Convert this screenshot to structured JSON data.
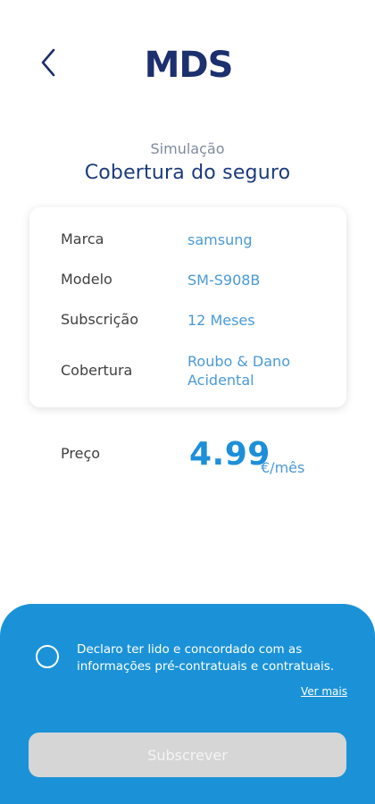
{
  "header": {
    "back_icon": "chevron-left-icon",
    "logo_text": "MDS",
    "brand_color": "#1c2f6e"
  },
  "page": {
    "subtitle": "Simulação",
    "title": "Cobertura do seguro"
  },
  "details": [
    {
      "label": "Marca",
      "value": "samsung"
    },
    {
      "label": "Modelo",
      "value": "SM-S908B"
    },
    {
      "label": "Subscrição",
      "value": "12 Meses"
    },
    {
      "label": "Cobertura",
      "value": "Roubo & Dano Acidental"
    }
  ],
  "price": {
    "label": "Preço",
    "value": "4.99",
    "unit": "€/mês"
  },
  "agreement": {
    "text": "Declaro ter lido e concordado com as informações pré-contratuais e contratuais.",
    "checked": false,
    "more_link": "Ver mais"
  },
  "subscribe_button": {
    "label": "Subscrever",
    "enabled": false
  },
  "colors": {
    "accent": "#1d8fd9",
    "panel": "#1b92d8",
    "title": "#1c3b7c",
    "disabled_button": "#d6d6d6"
  }
}
